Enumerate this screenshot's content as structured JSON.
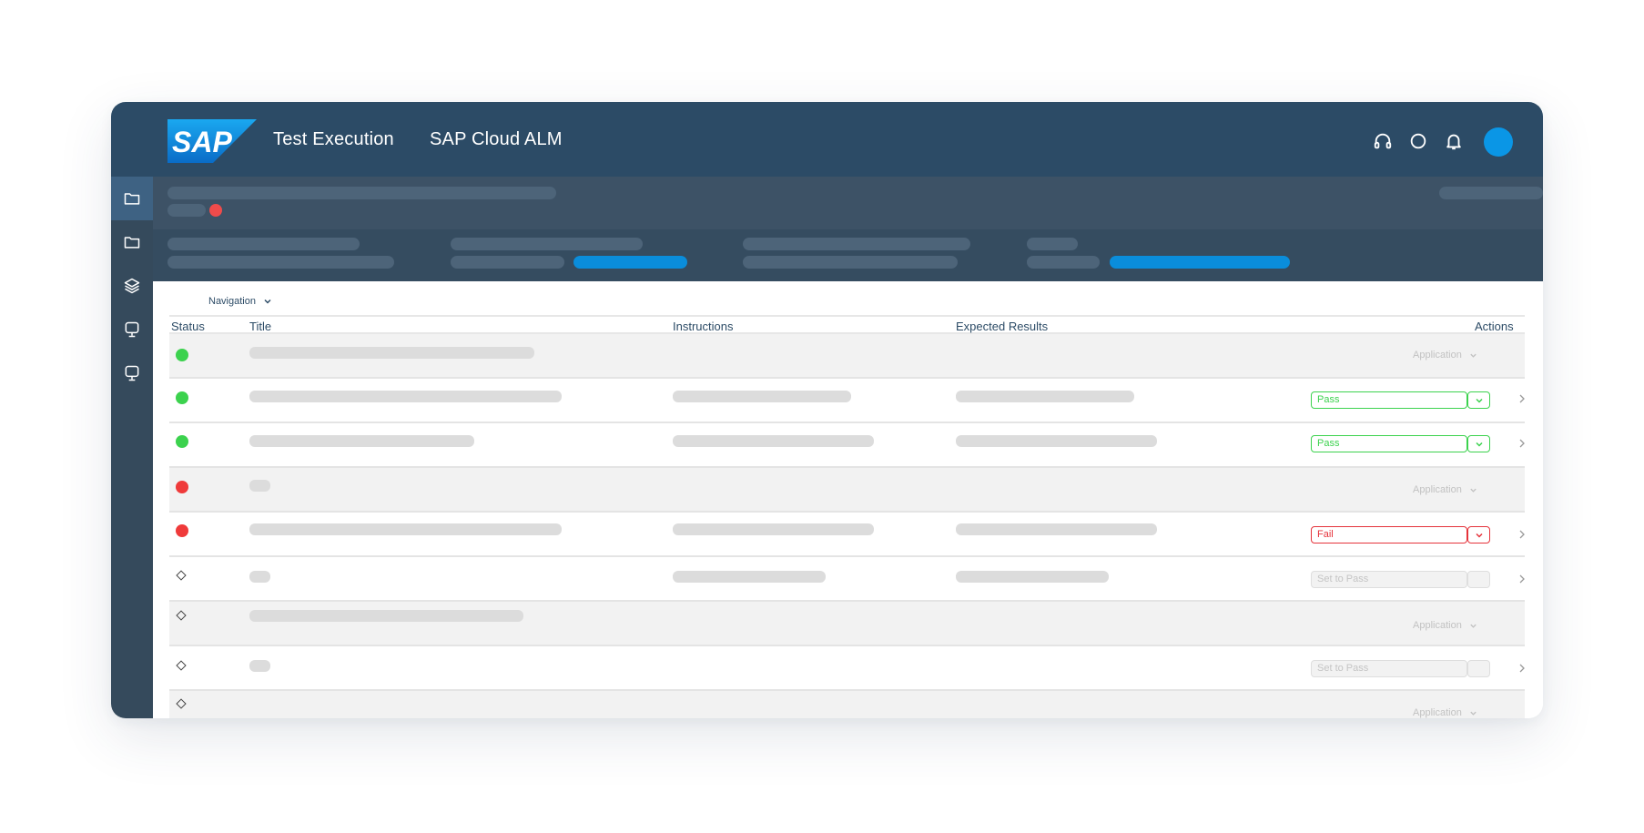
{
  "shellbar": {
    "logo_text": "SAP",
    "app_title": "Test Execution",
    "product": "SAP Cloud ALM",
    "icons": [
      "headset-icon",
      "help-circle-icon",
      "bell-icon",
      "user-avatar"
    ]
  },
  "sidenav": {
    "items": [
      "folder-icon",
      "folder-icon",
      "layers-icon",
      "monitor-icon",
      "monitor-icon"
    ],
    "active_index": 0
  },
  "toolbar": {
    "navigation_label": "Navigation"
  },
  "table": {
    "columns": [
      "Status",
      "Title",
      "Instructions",
      "Expected Results",
      "Actions"
    ],
    "rows": [
      {
        "status": "green",
        "action": "Application"
      },
      {
        "status": "green",
        "action": "Pass"
      },
      {
        "status": "green",
        "action": "Pass"
      },
      {
        "status": "red",
        "action": "Application"
      },
      {
        "status": "red",
        "action": "Fail"
      },
      {
        "status": "open",
        "action": "Set to Pass"
      },
      {
        "status": "open",
        "action": "Application"
      },
      {
        "status": "open",
        "action": "Set to Pass"
      },
      {
        "status": "open",
        "action": "Application"
      }
    ]
  },
  "colors": {
    "shellbar": "#2c4b66",
    "accent": "#0a8ddb",
    "pass": "#3cd24e",
    "fail": "#e5333b"
  }
}
